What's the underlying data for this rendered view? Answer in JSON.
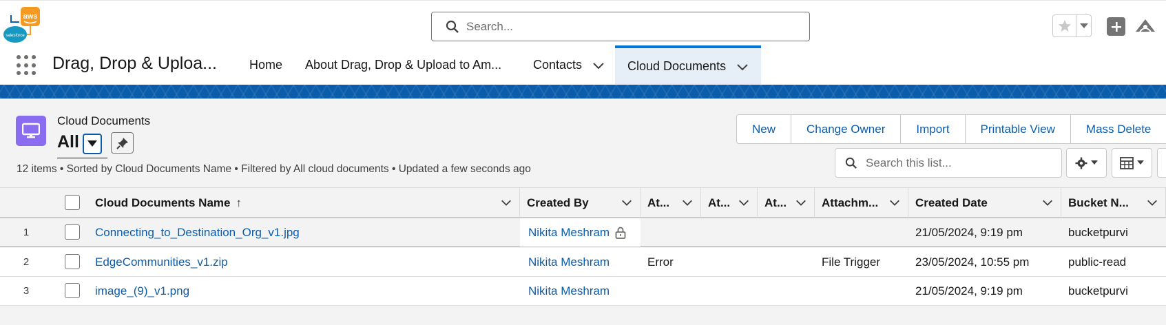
{
  "header": {
    "search_placeholder": "Search...",
    "accent": "#0176d3"
  },
  "nav": {
    "app_name": "Drag, Drop & Uploa...",
    "items": [
      {
        "label": "Home"
      },
      {
        "label": "About Drag, Drop & Upload to Am..."
      },
      {
        "label": "Contacts"
      },
      {
        "label": "Cloud Documents",
        "active": true
      }
    ]
  },
  "list_view": {
    "object_label": "Cloud Documents",
    "view_name": "All",
    "info": "12 items • Sorted by Cloud Documents Name • Filtered by All cloud documents • Updated a few seconds ago",
    "buttons": [
      "New",
      "Change Owner",
      "Import",
      "Printable View",
      "Mass Delete"
    ],
    "search_placeholder": "Search this list...",
    "columns": [
      "Cloud Documents Name",
      "Created By",
      "At...",
      "At...",
      "At...",
      "Attachm...",
      "Created Date",
      "Bucket N..."
    ],
    "sort_indicator": "↑",
    "rows": [
      {
        "num": "1",
        "name": "Connecting_to_Destination_Org_v1.jpg",
        "created_by": "Nikita Meshram",
        "at1": "",
        "at2": "",
        "at3": "",
        "attachment": "",
        "created_date": "21/05/2024, 9:19 pm",
        "bucket": "bucketpurvi"
      },
      {
        "num": "2",
        "name": "EdgeCommunities_v1.zip",
        "created_by": "Nikita Meshram",
        "at1": "Error",
        "at2": "",
        "at3": "",
        "attachment": "File Trigger",
        "created_date": "23/05/2024, 10:55 pm",
        "bucket": "public-read"
      },
      {
        "num": "3",
        "name": "image_(9)_v1.png",
        "created_by": "Nikita Meshram",
        "at1": "",
        "at2": "",
        "at3": "",
        "attachment": "",
        "created_date": "21/05/2024, 9:19 pm",
        "bucket": "bucketpurvi"
      }
    ]
  },
  "icons": {
    "logo": "aws-salesforce-logo-icon",
    "search": "search-icon",
    "favorite": "star-icon",
    "add": "plus-icon",
    "trailhead": "trailhead-icon",
    "app_launcher": "waffle-icon",
    "object": "monitor-icon",
    "pin": "pin-icon",
    "settings": "gear-icon",
    "display": "table-icon",
    "lock": "lock-icon"
  }
}
